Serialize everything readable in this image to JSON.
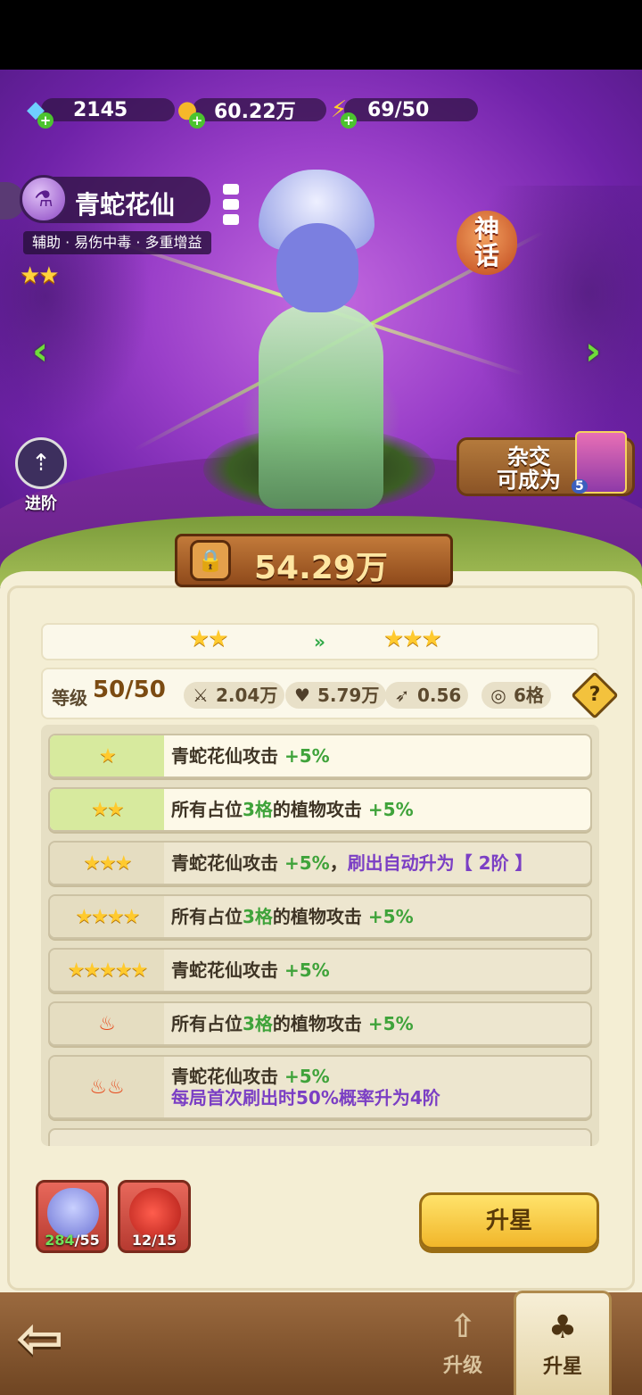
{
  "currencies": [
    {
      "icon": "diamond-icon",
      "value": "2145"
    },
    {
      "icon": "coin-icon",
      "value": "60.22万"
    },
    {
      "icon": "energy-icon",
      "value": "69/50"
    }
  ],
  "hero": {
    "name": "青蛇花仙",
    "tags": "辅助 · 易伤中毒 · 多重增益",
    "stars": "★★",
    "rarity_badge": "神\n话",
    "power": "54.29万"
  },
  "side_buttons": {
    "advance_label": "进阶",
    "hybrid_label": "杂交\n可成为",
    "hybrid_badge": "5"
  },
  "upgrade": {
    "current_stars": "★★",
    "next_stars": "★★★",
    "arrow": "»"
  },
  "stats": {
    "level_label": "等级",
    "level_value": "50/50",
    "attack": "2.04万",
    "hp": "5.79万",
    "speed": "0.56",
    "slots": "6格",
    "help": "?"
  },
  "bonuses": [
    {
      "marker": "★",
      "segments": [
        {
          "t": "青蛇花仙攻击 ",
          "c": ""
        },
        {
          "t": "+5%",
          "c": "g"
        }
      ],
      "active": true
    },
    {
      "marker": "★★",
      "segments": [
        {
          "t": "所有占位",
          "c": ""
        },
        {
          "t": "3格",
          "c": "g"
        },
        {
          "t": "的植物攻击 ",
          "c": ""
        },
        {
          "t": "+5%",
          "c": "g"
        }
      ],
      "active": true
    },
    {
      "marker": "★★★",
      "segments": [
        {
          "t": "青蛇花仙攻击 ",
          "c": ""
        },
        {
          "t": "+5%",
          "c": "g"
        },
        {
          "t": "，",
          "c": ""
        },
        {
          "t": "刷出自动升为【 2阶 】",
          "c": "p"
        }
      ],
      "active": false
    },
    {
      "marker": "★★★★",
      "segments": [
        {
          "t": "所有占位",
          "c": ""
        },
        {
          "t": "3格",
          "c": "g"
        },
        {
          "t": "的植物攻击 ",
          "c": ""
        },
        {
          "t": "+5%",
          "c": "g"
        }
      ],
      "active": false
    },
    {
      "marker": "★★★★★",
      "segments": [
        {
          "t": "青蛇花仙攻击 ",
          "c": ""
        },
        {
          "t": "+5%",
          "c": "g"
        }
      ],
      "active": false
    },
    {
      "marker": "flame-1",
      "segments": [
        {
          "t": "所有占位",
          "c": ""
        },
        {
          "t": "3格",
          "c": "g"
        },
        {
          "t": "的植物攻击 ",
          "c": ""
        },
        {
          "t": "+5%",
          "c": "g"
        }
      ],
      "active": false
    },
    {
      "marker": "flame-2",
      "segments": [
        {
          "t": "青蛇花仙攻击 ",
          "c": ""
        },
        {
          "t": "+5%",
          "c": "g"
        }
      ],
      "line2": "每局首次刷出时50%概率升为4阶",
      "active": false
    }
  ],
  "materials": [
    {
      "name": "hero-fragment",
      "have": "284",
      "need": "/55"
    },
    {
      "name": "apple-item",
      "have": "12",
      "need": "/15"
    }
  ],
  "actions": {
    "upgrade_star": "升星"
  },
  "nav": {
    "back": "⇦",
    "level_up": "升级",
    "star_up": "升星"
  },
  "colors": {
    "accent_green": "#3fa33a",
    "accent_purple": "#7b3fc4",
    "button_gold": "#f1b62a"
  }
}
